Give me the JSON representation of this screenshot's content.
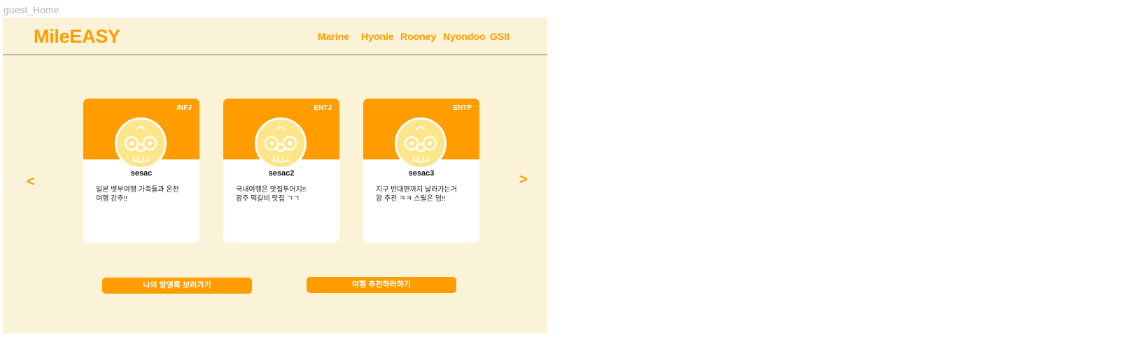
{
  "frame_label": "guest_Home",
  "header": {
    "logo": "MileEASY",
    "nav": [
      "Marine",
      "Hyonie",
      "Rooney",
      "Nyondoo",
      "GSII"
    ]
  },
  "carousel": {
    "prev_label": "<",
    "next_label": ">",
    "cards": [
      {
        "mbti": "INFJ",
        "username": "sesac",
        "description": "일본 벳부여행 가족들과 온천\n여행 강추!!"
      },
      {
        "mbti": "ENTJ",
        "username": "sesac2",
        "description": "국내여행은 맛집투어지!!\n광주 떡갈비 맛집 ㄱㄱ"
      },
      {
        "mbti": "ENTP",
        "username": "sesac3",
        "description": "지구 반대편까지 날라가는거\n왕 추천 ㅋㅋ 스릴은 덤!!"
      }
    ],
    "avatar_icon": "chick-mascot-icon"
  },
  "buttons": {
    "guestbook": "나의 방명록 보러가기",
    "recommend": "여행 추천하러하기"
  },
  "colors": {
    "accent": "#ff9c00",
    "background": "#fbf3d8",
    "avatar": "#ffe58a"
  }
}
